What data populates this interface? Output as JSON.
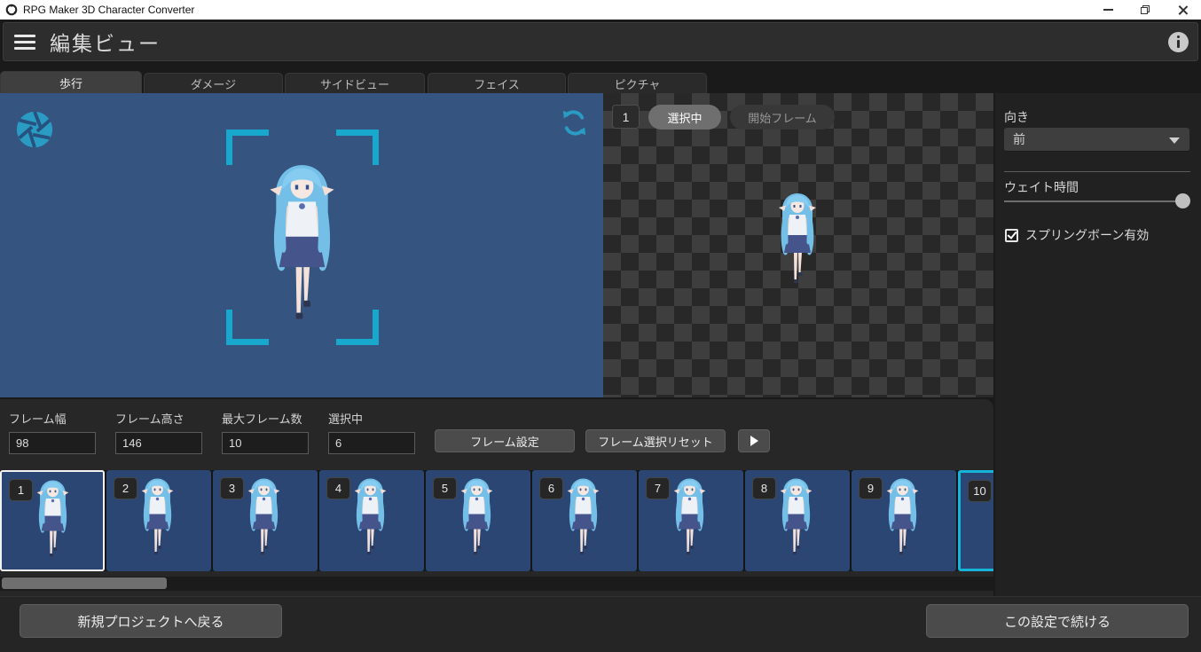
{
  "titlebar": {
    "title": "RPG Maker 3D Character Converter"
  },
  "header": {
    "title": "編集ビュー"
  },
  "tabs": [
    {
      "label": "歩行",
      "active": true
    },
    {
      "label": "ダメージ",
      "active": false
    },
    {
      "label": "サイドビュー",
      "active": false
    },
    {
      "label": "フェイス",
      "active": false
    },
    {
      "label": "ピクチャ",
      "active": false
    }
  ],
  "stage": {
    "frame_number": "1",
    "selected_pill": "選択中",
    "start_frame_pill": "開始フレーム"
  },
  "side_panel": {
    "direction_label": "向き",
    "direction_value": "前",
    "wait_time_label": "ウェイト時間",
    "spring_bone_label": "スプリングボーン有効",
    "spring_bone_checked": true
  },
  "frame_settings": {
    "fields": [
      {
        "label": "フレーム幅",
        "value": "98"
      },
      {
        "label": "フレーム高さ",
        "value": "146"
      },
      {
        "label": "最大フレーム数",
        "value": "10"
      },
      {
        "label": "選択中",
        "value": "6"
      }
    ],
    "set_button": "フレーム設定",
    "reset_button": "フレーム選択リセット"
  },
  "filmstrip": {
    "frames": [
      {
        "number": "1",
        "selected": "white"
      },
      {
        "number": "2",
        "selected": "none"
      },
      {
        "number": "3",
        "selected": "none"
      },
      {
        "number": "4",
        "selected": "none"
      },
      {
        "number": "5",
        "selected": "none"
      },
      {
        "number": "6",
        "selected": "none"
      },
      {
        "number": "7",
        "selected": "none"
      },
      {
        "number": "8",
        "selected": "none"
      },
      {
        "number": "9",
        "selected": "none"
      },
      {
        "number": "10",
        "selected": "cyan"
      }
    ]
  },
  "footer": {
    "back_button": "新規プロジェクトへ戻る",
    "continue_button": "この設定で続ける"
  },
  "colors": {
    "preview_bg": "#35547f",
    "frame_bg": "#2c4674",
    "accent_cyan": "#18a8cd",
    "selection_white": "#f2f2f2",
    "selection_cyan": "#15b4d8"
  }
}
